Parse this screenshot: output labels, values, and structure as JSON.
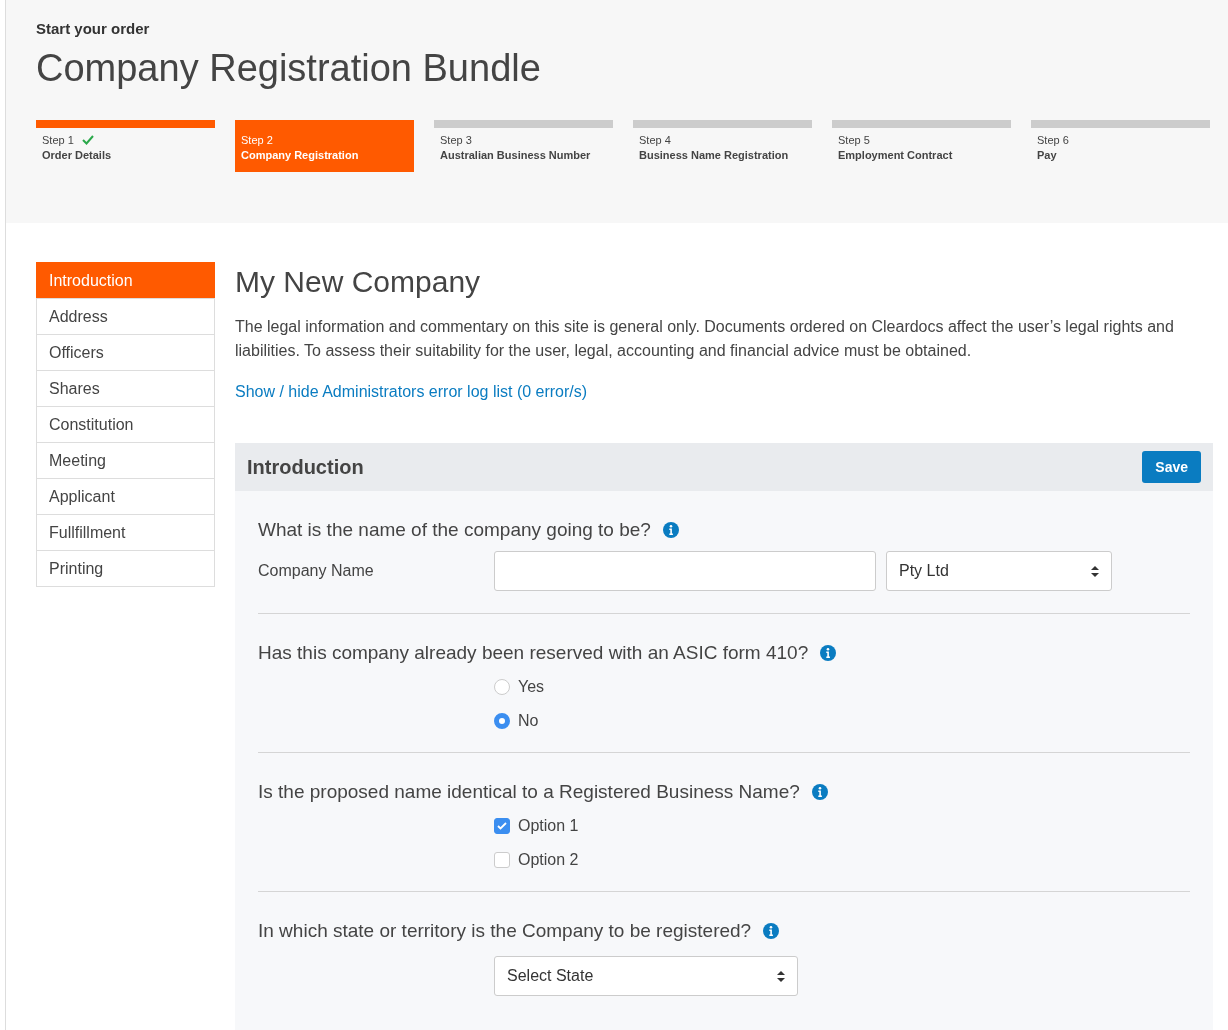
{
  "header": {
    "eyebrow": "Start your order",
    "title": "Company Registration Bundle"
  },
  "steps": [
    {
      "number": "Step 1",
      "label": "Order Details",
      "completed": true,
      "selected": false
    },
    {
      "number": "Step 2",
      "label": "Company Registration",
      "completed": false,
      "selected": true
    },
    {
      "number": "Step 3",
      "label": "Australian Business Number",
      "completed": false,
      "selected": false
    },
    {
      "number": "Step 4",
      "label": "Business Name Registration",
      "completed": false,
      "selected": false
    },
    {
      "number": "Step 5",
      "label": "Employment Contract",
      "completed": false,
      "selected": false
    },
    {
      "number": "Step 6",
      "label": "Pay",
      "completed": false,
      "selected": false
    }
  ],
  "sidebar": {
    "items": [
      {
        "label": "Introduction",
        "selected": true
      },
      {
        "label": "Address",
        "selected": false
      },
      {
        "label": "Officers",
        "selected": false
      },
      {
        "label": "Shares",
        "selected": false
      },
      {
        "label": "Constitution",
        "selected": false
      },
      {
        "label": "Meeting",
        "selected": false
      },
      {
        "label": "Applicant",
        "selected": false
      },
      {
        "label": "Fullfillment",
        "selected": false
      },
      {
        "label": "Printing",
        "selected": false
      }
    ]
  },
  "content": {
    "title": "My New Company",
    "disclaimer": "The legal information and commentary on this site is general only. Documents ordered on Cleardocs affect the user’s legal rights and liabilities. To assess their suitability for the user, legal, accounting and financial advice must be obtained.",
    "error_link": "Show / hide Administrators error log list (0 error/s)"
  },
  "panel": {
    "title": "Introduction",
    "save_button": "Save",
    "questions": [
      {
        "kind": "name",
        "question": "What is the name of the company going to be?",
        "label": "Company Name",
        "suffix_select": "Pty Ltd"
      },
      {
        "kind": "radio",
        "question": "Has this company already been reserved with an ASIC form 410?",
        "options": [
          {
            "label": "Yes",
            "selected": false
          },
          {
            "label": "No",
            "selected": true
          }
        ]
      },
      {
        "kind": "checkbox",
        "question": "Is the proposed name identical to a Registered Business Name?",
        "options": [
          {
            "label": "Option 1",
            "checked": true
          },
          {
            "label": "Option 2",
            "checked": false
          }
        ]
      },
      {
        "kind": "select",
        "question": "In which state or territory is the Company to be registered?",
        "select": "Select State"
      }
    ]
  }
}
